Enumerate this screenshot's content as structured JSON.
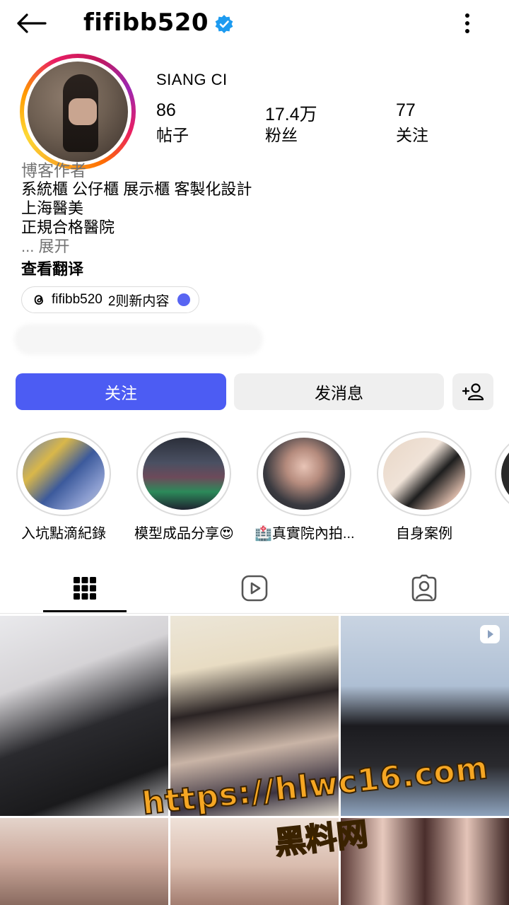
{
  "header": {
    "username": "fifibb520",
    "back_icon": "arrow-left-icon",
    "verified_icon": "verified-badge-icon",
    "more_icon": "more-vertical-icon"
  },
  "profile": {
    "display_name": "SIANG CI",
    "stats": [
      {
        "value": "86",
        "label": "帖子"
      },
      {
        "value": "17.4万",
        "label": "粉丝"
      },
      {
        "value": "77",
        "label": "关注"
      }
    ],
    "category": "博客作者",
    "bio_lines": [
      "系統櫃 公仔櫃 展示櫃 客製化設計",
      "上海醫美",
      "正規合格醫院"
    ],
    "expand": "... 展开",
    "translate": "查看翻译",
    "threads": {
      "handle": "fifibb520",
      "text": "2则新内容"
    }
  },
  "actions": {
    "follow": "关注",
    "message": "发消息",
    "add_user_icon": "add-person-icon"
  },
  "highlights": [
    {
      "label": "入坑點滴紀錄"
    },
    {
      "label": "模型成品分享😍"
    },
    {
      "label": "🏥真實院內拍..."
    },
    {
      "label": "自身案例"
    }
  ],
  "tabs": [
    {
      "name": "grid-icon",
      "active": true
    },
    {
      "name": "reels-icon",
      "active": false
    },
    {
      "name": "tagged-icon",
      "active": false
    }
  ],
  "watermark": {
    "url": "https://hlwc16.com",
    "site": "黑料网"
  },
  "colors": {
    "primary_button": "#4c5cf3",
    "secondary_button": "#efefef",
    "verified": "#1d9bf0",
    "muted_text": "#737373"
  }
}
